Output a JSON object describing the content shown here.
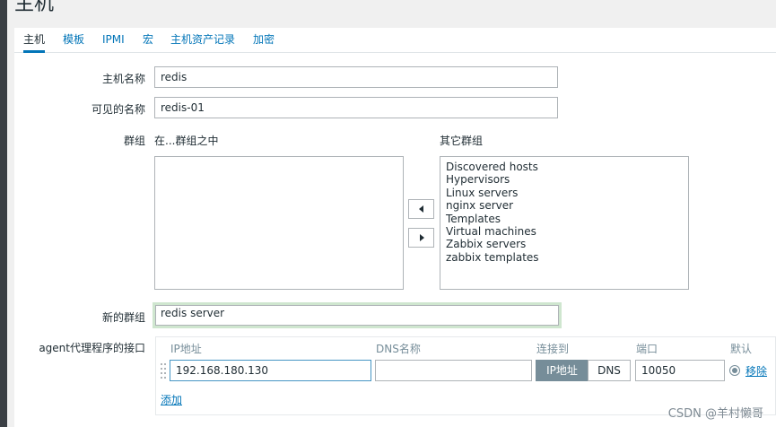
{
  "page": {
    "title": "主机"
  },
  "tabs": [
    {
      "label": "主机",
      "active": true
    },
    {
      "label": "模板"
    },
    {
      "label": "IPMI"
    },
    {
      "label": "宏"
    },
    {
      "label": "主机资产记录"
    },
    {
      "label": "加密"
    }
  ],
  "form": {
    "host_name": {
      "label": "主机名称",
      "value": "redis"
    },
    "visible_name": {
      "label": "可见的名称",
      "value": "redis-01"
    },
    "groups": {
      "label": "群组",
      "in_groups_label": "在...群组之中",
      "other_groups_label": "其它群组",
      "other_groups": [
        "Discovered hosts",
        "Hypervisors",
        "Linux servers",
        "nginx server",
        "Templates",
        "Virtual machines",
        "Zabbix servers",
        "zabbix templates"
      ],
      "move_left_icon": "triangle-left-icon",
      "move_right_icon": "triangle-right-icon"
    },
    "new_group": {
      "label": "新的群组",
      "value": "redis server"
    },
    "agent_interfaces": {
      "label": "agent代理程序的接口",
      "columns": {
        "ip": "IP地址",
        "dns": "DNS名称",
        "connect_to": "连接到",
        "port": "端口",
        "default": "默认"
      },
      "row": {
        "ip": "192.168.180.130",
        "dns": "",
        "connect_ip_label": "IP地址",
        "connect_dns_label": "DNS",
        "port": "10050",
        "remove_label": "移除"
      },
      "add_label": "添加"
    }
  },
  "watermark": "CSDN @羊村懒哥",
  "colors": {
    "link": "#0275b8",
    "segment_active": "#768d99",
    "focus_border": "#cfe6cf"
  }
}
